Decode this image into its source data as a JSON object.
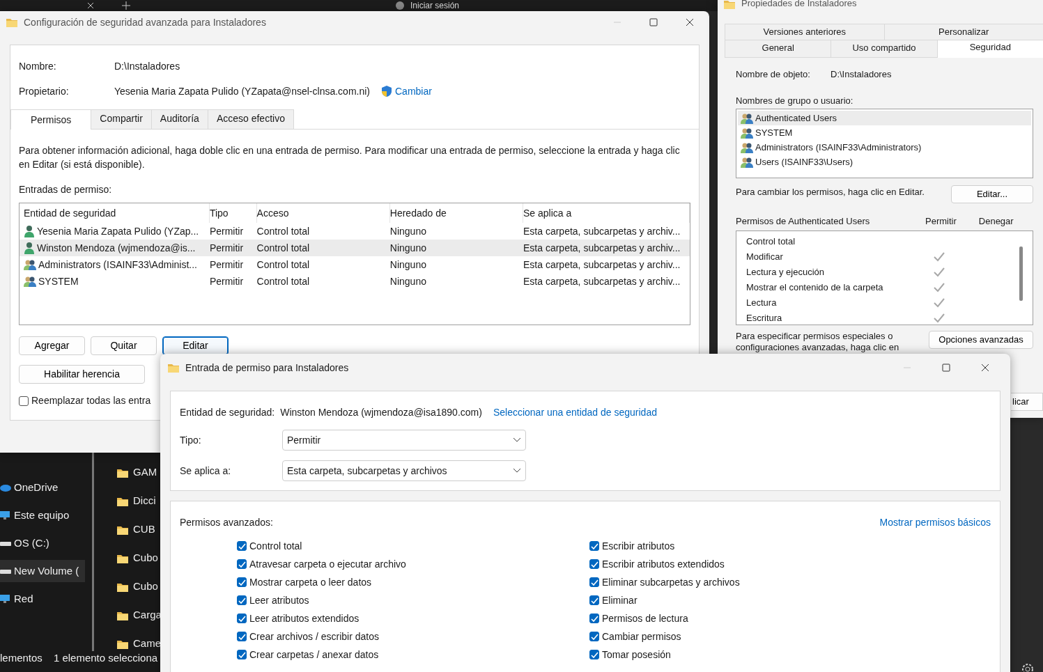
{
  "browser_strip": {
    "sign_in": "Iniciar sesión"
  },
  "explorer": {
    "nav": [
      {
        "label": "OneDrive",
        "kind": "cloud",
        "selected": false
      },
      {
        "label": "Este equipo",
        "kind": "computer",
        "selected": false
      },
      {
        "label": "OS (C:)",
        "kind": "drive",
        "selected": false
      },
      {
        "label": "New Volume (",
        "kind": "drive",
        "selected": true
      },
      {
        "label": "Red",
        "kind": "computer",
        "selected": false
      }
    ],
    "files": [
      "GAM",
      "Dicci",
      "CUB",
      "Cubo",
      "Cubo",
      "Carga",
      "Came"
    ],
    "status": [
      "lementos",
      "1 elemento selecciona"
    ]
  },
  "advanced_window": {
    "title": "Configuración de seguridad avanzada para Instaladores",
    "name_label": "Nombre:",
    "name_value": "D:\\Instaladores",
    "owner_label": "Propietario:",
    "owner_value": "Yesenia Maria Zapata Pulido (YZapata@nsel-clnsa.com.ni)",
    "owner_link": "Cambiar",
    "tabs": [
      {
        "label": "Permisos",
        "selected": true
      },
      {
        "label": "Compartir",
        "selected": false
      },
      {
        "label": "Auditoría",
        "selected": false
      },
      {
        "label": "Acceso efectivo",
        "selected": false
      }
    ],
    "info": "Para obtener información adicional, haga doble clic en una entrada de permiso. Para modificar una entrada de permiso, seleccione la entrada y haga clic en Editar (si está disponible).",
    "entries_label": "Entradas de permiso:",
    "table": {
      "columns": [
        "Entidad de seguridad",
        "Tipo",
        "Acceso",
        "Heredado de",
        "Se aplica a"
      ],
      "rows": [
        {
          "kind": "user",
          "selected": false,
          "cells": [
            "Yesenia Maria Zapata Pulido (YZap...",
            "Permitir",
            "Control total",
            "Ninguno",
            "Esta carpeta, subcarpetas y archiv..."
          ]
        },
        {
          "kind": "user",
          "selected": true,
          "cells": [
            "Winston Mendoza (wjmendoza@is...",
            "Permitir",
            "Control total",
            "Ninguno",
            "Esta carpeta, subcarpetas y archiv..."
          ]
        },
        {
          "kind": "group",
          "selected": false,
          "cells": [
            "Administrators (ISAINF33\\Administ...",
            "Permitir",
            "Control total",
            "Ninguno",
            "Esta carpeta, subcarpetas y archiv..."
          ]
        },
        {
          "kind": "group",
          "selected": false,
          "cells": [
            "SYSTEM",
            "Permitir",
            "Control total",
            "Ninguno",
            "Esta carpeta, subcarpetas y archiv..."
          ]
        }
      ]
    },
    "buttons": [
      {
        "label": "Agregar",
        "focused": false
      },
      {
        "label": "Quitar",
        "focused": false
      },
      {
        "label": "Editar",
        "focused": true
      }
    ],
    "inherit_button": "Habilitar herencia",
    "replace_checkbox": {
      "label": "Reemplazar todas las entra",
      "checked": false
    }
  },
  "properties_window": {
    "title": "Propiedades de Instaladores",
    "tabs_back": [
      {
        "label": "Versiones anteriores",
        "selected": false
      },
      {
        "label": "Personalizar",
        "selected": false
      }
    ],
    "tabs_front": [
      {
        "label": "General",
        "selected": false
      },
      {
        "label": "Uso compartido",
        "selected": false
      },
      {
        "label": "Seguridad",
        "selected": true
      }
    ],
    "object_label": "Nombre de objeto:",
    "object_value": "D:\\Instaladores",
    "groups_label": "Nombres de grupo o usuario:",
    "groups": [
      {
        "label": "Authenticated Users",
        "selected": true
      },
      {
        "label": "SYSTEM",
        "selected": false
      },
      {
        "label": "Administrators (ISAINF33\\Administrators)",
        "selected": false
      },
      {
        "label": "Users (ISAINF33\\Users)",
        "selected": false
      }
    ],
    "change_hint": "Para cambiar los permisos, haga clic en Editar.",
    "edit_button": "Editar...",
    "perms_label": "Permisos de Authenticated Users",
    "allow_label": "Permitir",
    "deny_label": "Denegar",
    "perms": [
      {
        "label": "Control total",
        "allow": false
      },
      {
        "label": "Modificar",
        "allow": true
      },
      {
        "label": "Lectura y ejecución",
        "allow": true
      },
      {
        "label": "Mostrar el contenido de la carpeta",
        "allow": true
      },
      {
        "label": "Lectura",
        "allow": true
      },
      {
        "label": "Escritura",
        "allow": true
      }
    ],
    "advanced_hint": "Para especificar permisos especiales o configuraciones avanzadas, haga clic en",
    "advanced_button": "Opciones avanzadas",
    "apply_button": "licar"
  },
  "entry_dialog": {
    "title": "Entrada de permiso para Instaladores",
    "principal_label": "Entidad de seguridad:",
    "principal_value": "Winston Mendoza (wjmendoza@isa1890.com)",
    "principal_link": "Seleccionar una entidad de seguridad",
    "type_label": "Tipo:",
    "type_value": "Permitir",
    "applies_label": "Se aplica a:",
    "applies_value": "Esta carpeta, subcarpetas y archivos",
    "advanced_label": "Permisos avanzados:",
    "basic_link": "Mostrar permisos básicos",
    "perms_left": [
      {
        "label": "Control total",
        "checked": true
      },
      {
        "label": "Atravesar carpeta o ejecutar archivo",
        "checked": true
      },
      {
        "label": "Mostrar carpeta o leer datos",
        "checked": true
      },
      {
        "label": "Leer atributos",
        "checked": true
      },
      {
        "label": "Leer atributos extendidos",
        "checked": true
      },
      {
        "label": "Crear archivos / escribir datos",
        "checked": true
      },
      {
        "label": "Crear carpetas / anexar datos",
        "checked": true
      }
    ],
    "perms_right": [
      {
        "label": "Escribir atributos",
        "checked": true
      },
      {
        "label": "Escribir atributos extendidos",
        "checked": true
      },
      {
        "label": "Eliminar subcarpetas y archivos",
        "checked": true
      },
      {
        "label": "Eliminar",
        "checked": true
      },
      {
        "label": "Permisos de lectura",
        "checked": true
      },
      {
        "label": "Cambiar permisos",
        "checked": true
      },
      {
        "label": "Tomar posesión",
        "checked": true
      }
    ]
  }
}
